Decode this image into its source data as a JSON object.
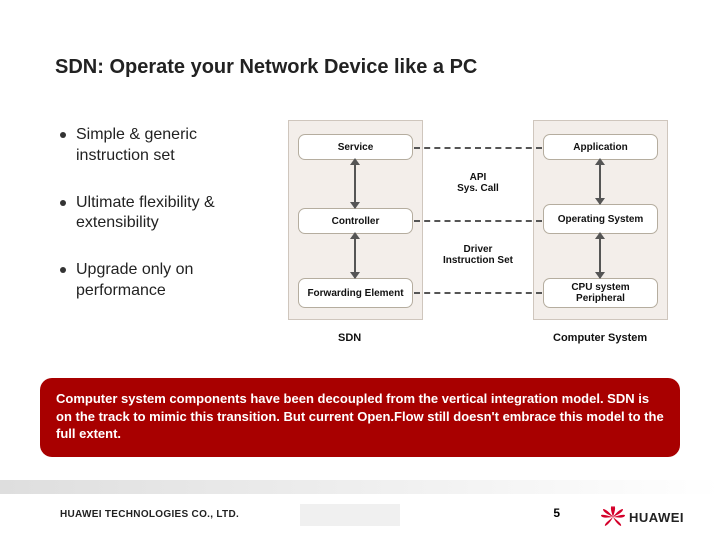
{
  "title": "SDN: Operate your Network Device like a PC",
  "bullets": [
    "Simple & generic instruction set",
    "Ultimate flexibility & extensibility",
    "Upgrade only on performance"
  ],
  "diagram": {
    "left_col_label": "SDN",
    "right_col_label": "Computer System",
    "left_boxes": [
      "Service",
      "Controller",
      "Forwarding Element"
    ],
    "right_boxes": [
      "Application",
      "Operating System",
      "CPU system Peripheral"
    ],
    "conn_labels": [
      "API\nSys. Call",
      "Driver\nInstruction Set"
    ]
  },
  "red_band_text": "Computer system components have been decoupled from the vertical integration model. SDN is on the track to mimic this transition. But current Open.Flow still doesn't embrace this model to the full extent.",
  "footer": {
    "copyright": "HUAWEI TECHNOLOGIES CO., LTD.",
    "page": "5",
    "logo_text": "HUAWEI"
  }
}
